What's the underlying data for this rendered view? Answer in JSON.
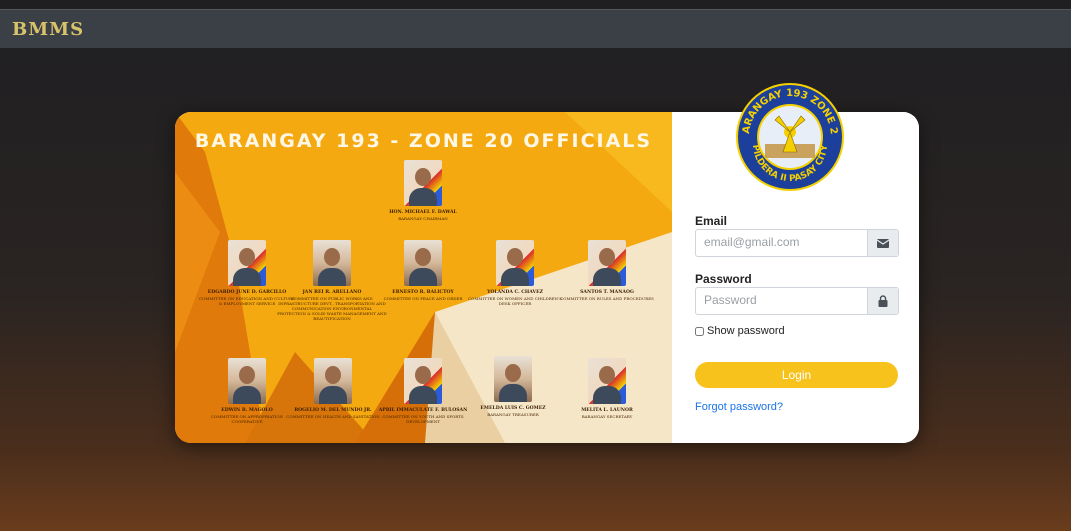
{
  "app": {
    "brand": "BMMS"
  },
  "poster": {
    "title": "BARANGAY 193 - ZONE 20 OFFICIALS",
    "officials": [
      {
        "name": "HON. MICHAEL F. DAWAL",
        "role": "BARANGAY CHAIRMAN"
      },
      {
        "name": "EDGARDO JUNE D. GARCILLO",
        "role": "COMMITTEE ON EDUCATION AND CULTURE & EMPLOYMENT SERVICE"
      },
      {
        "name": "JAN REI R. ARELLANO",
        "role": "COMMITTEE ON PUBLIC WORKS AND INFRASTRUCTURE DEVT., TRANSPORTATION AND COMMUNICATION ENVIRONMENTAL PROTECTION & SOLID WASTE MANAGEMENT AND BEAUTIFICATION"
      },
      {
        "name": "ERNESTO R. BALICTOY",
        "role": "COMMITTEE ON PEACE AND ORDER"
      },
      {
        "name": "YOLANDA C. CHAVEZ",
        "role": "COMMITTEE ON WOMEN AND CHILDREN'S DESK OFFICER"
      },
      {
        "name": "SANTOS T. MANAOG",
        "role": "COMMITTEE ON RULES AND PROCEDURES"
      },
      {
        "name": "EDWIN B. MAGOLO",
        "role": "COMMITTEE ON APPROPRIATION COOPERATIVE"
      },
      {
        "name": "ROGELIO M. DEL MUNDO JR.",
        "role": "COMMITTEE ON HEALTH AND SANITATION"
      },
      {
        "name": "APRIL IMMACULATE F. BULOSAN",
        "role": "COMMITTEE ON YOUTH AND SPORTS DEVELOPMENT"
      },
      {
        "name": "EMELDA LUIS C. GOMEZ",
        "role": "BARANGAY TREASURER"
      },
      {
        "name": "MELITA L. LAUNOR",
        "role": "BARANGAY SECRETARY"
      }
    ]
  },
  "seal": {
    "text_top": "BARANGAY 193 ZONE 20",
    "text_bottom": "PILDERA II PASAY CITY"
  },
  "form": {
    "email_label": "Email",
    "email_placeholder": "email@gmail.com",
    "email_icon": "envelope-icon",
    "password_label": "Password",
    "password_placeholder": "Password",
    "password_icon": "lock-icon",
    "show_password_label": "Show password",
    "login_label": "Login",
    "forgot_label": "Forgot password?"
  },
  "colors": {
    "accent": "#f7c21c",
    "link": "#1a73e8",
    "topbar": "#3b4046",
    "brand": "#d9c36a"
  }
}
